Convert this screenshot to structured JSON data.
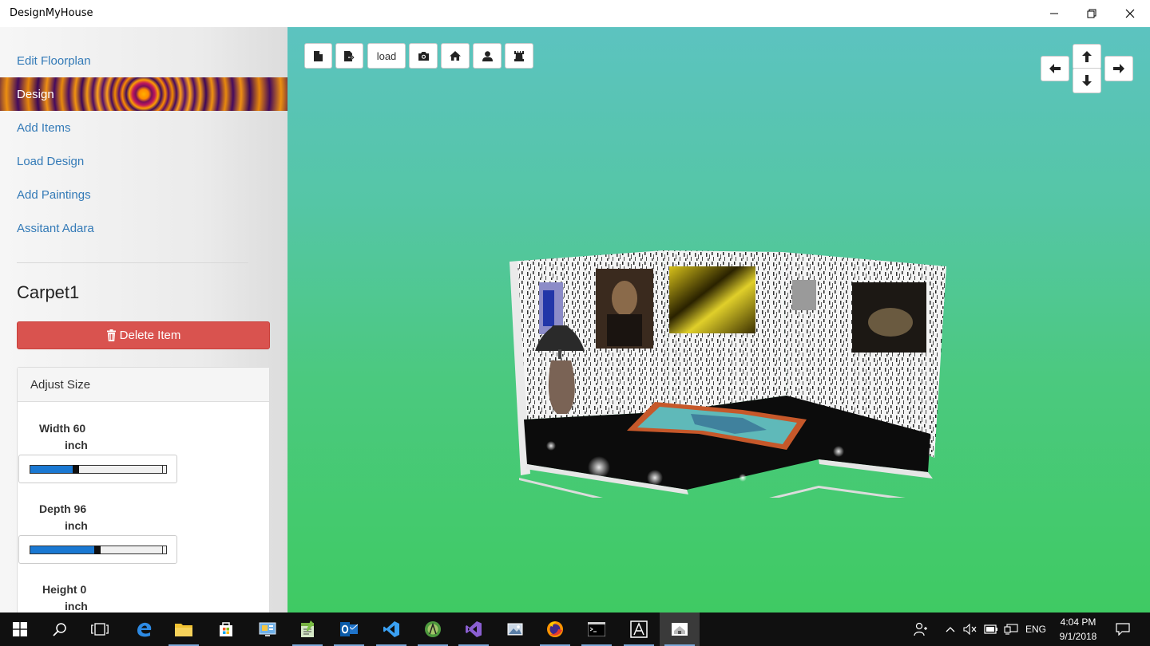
{
  "window": {
    "title": "DesignMyHouse"
  },
  "sidebar": {
    "items": [
      {
        "label": "Edit Floorplan",
        "active": false
      },
      {
        "label": "Design",
        "active": true
      },
      {
        "label": "Add Items",
        "active": false
      },
      {
        "label": "Load Design",
        "active": false
      },
      {
        "label": "Add Paintings",
        "active": false
      },
      {
        "label": "Assitant Adara",
        "active": false
      }
    ],
    "selected_item": "Carpet1",
    "delete_label": "Delete Item",
    "adjust_size": {
      "heading": "Adjust Size",
      "width": {
        "label": "Width 60",
        "unit": "inch",
        "fraction": 0.31
      },
      "depth": {
        "label": "Depth 96",
        "unit": "inch",
        "fraction": 0.47
      },
      "height": {
        "label": "Height 0",
        "unit": "inch"
      }
    }
  },
  "toolbar": {
    "buttons": [
      {
        "name": "new-file-button",
        "icon": "file-icon"
      },
      {
        "name": "save-file-button",
        "icon": "file-export-icon"
      },
      {
        "name": "load-button",
        "label": "load"
      },
      {
        "name": "screenshot-button",
        "icon": "camera-icon"
      },
      {
        "name": "home-view-button",
        "icon": "home-icon"
      },
      {
        "name": "person-view-button",
        "icon": "user-icon"
      },
      {
        "name": "top-view-button",
        "icon": "tower-icon"
      }
    ]
  },
  "camera_controls": {
    "icons": [
      "arrow-left-icon",
      "arrow-up-icon",
      "arrow-down-icon",
      "arrow-right-icon"
    ]
  },
  "taskbar": {
    "language": "ENG",
    "time": "4:04 PM",
    "date": "9/1/2018",
    "apps": [
      "start",
      "search",
      "task-view",
      "edge",
      "file-explorer",
      "store",
      "control-panel",
      "notepad-plus",
      "outlook",
      "vscode",
      "android-studio",
      "visual-studio",
      "photos",
      "firefox",
      "terminal",
      "autocad",
      "design-my-house"
    ]
  },
  "colors": {
    "link": "#337ab7",
    "delete": "#d9534f",
    "viewport_top": "#5cc3c0",
    "viewport_bottom": "#3fca63",
    "slider_fill": "#1a78d2"
  }
}
